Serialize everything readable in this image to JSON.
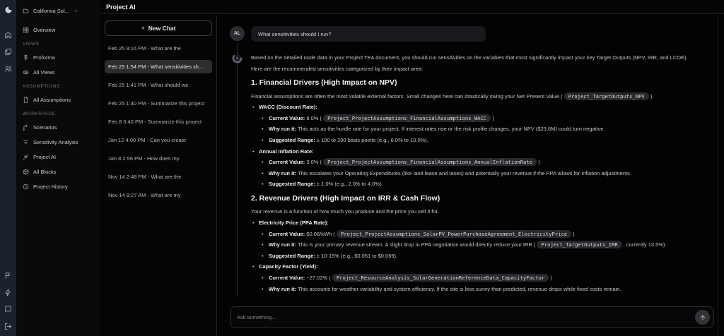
{
  "header": {
    "title": "Project AI"
  },
  "sidebar": {
    "project_label": "California Sol...",
    "overview_label": "Overview",
    "sections": [
      {
        "label": "VIEWS",
        "items": [
          {
            "label": "Proforma"
          },
          {
            "label": "All Views"
          }
        ]
      },
      {
        "label": "ASSUMPTIONS",
        "items": [
          {
            "label": "All Assumptions"
          }
        ]
      },
      {
        "label": "WORKSPACE",
        "items": [
          {
            "label": "Scenarios"
          },
          {
            "label": "Sensitivity Analysis"
          },
          {
            "label": "Project AI"
          },
          {
            "label": "All Blocks"
          },
          {
            "label": "Project History"
          }
        ]
      }
    ]
  },
  "chat_panel": {
    "new_chat_label": "New Chat",
    "items": [
      {
        "label": "Feb 25 9:16 PM - What are the",
        "selected": false
      },
      {
        "label": "Feb 25 1:54 PM - What sensitivities sh...",
        "selected": true
      },
      {
        "label": "Feb 25 1:41 PM - What should we",
        "selected": false
      },
      {
        "label": "Feb 25 1:40 PM - Summarize this project",
        "selected": false
      },
      {
        "label": "Feb 8 3:40 PM - Summarize this project",
        "selected": false
      },
      {
        "label": "Jan 12 4:00 PM - Can you create",
        "selected": false
      },
      {
        "label": "Jan 8 2:56 PM - How does my",
        "selected": false
      },
      {
        "label": "Nov 14 2:48 PM - What are the",
        "selected": false
      },
      {
        "label": "Nov 14 9:27 AM - What are my",
        "selected": false
      }
    ]
  },
  "conversation": {
    "user": {
      "avatar_initials": "AL",
      "message": "What sensitivities should I run?"
    },
    "assistant": {
      "blocks": [
        {
          "type": "p",
          "parts": [
            {
              "t": "text",
              "v": "Based on the detailed node data in your Project TEA document, you should run sensitivities on the variables that most significantly impact your key Target Outputs (NPV, IRR, and LCOE)."
            }
          ]
        },
        {
          "type": "p",
          "parts": [
            {
              "t": "text",
              "v": "Here are the recommended sensitivities categorized by their impact area:"
            }
          ]
        },
        {
          "type": "h3",
          "parts": [
            {
              "t": "text",
              "v": "1. Financial Drivers (High Impact on NPV)"
            }
          ]
        },
        {
          "type": "p",
          "parts": [
            {
              "t": "text",
              "v": "Financial assumptions are often the most volatile external factors. Small changes here can drastically swing your Net Present Value ( "
            },
            {
              "t": "code",
              "v": "Project_TargetOutputs_NPV"
            },
            {
              "t": "text",
              "v": " )."
            }
          ]
        },
        {
          "type": "li1",
          "parts": [
            {
              "t": "bold",
              "v": "WACC (Discount Rate):"
            }
          ]
        },
        {
          "type": "li2",
          "parts": [
            {
              "t": "bold",
              "v": "Current Value:"
            },
            {
              "t": "text",
              "v": " 8.0% ( "
            },
            {
              "t": "code",
              "v": "Project_ProjectAssumptions_FinancialAssumptions_WACC"
            },
            {
              "t": "text",
              "v": " )"
            }
          ]
        },
        {
          "type": "li2",
          "parts": [
            {
              "t": "bold",
              "v": "Why run it:"
            },
            {
              "t": "text",
              "v": " This acts as the hurdle rate for your project. If interest rates rise or the risk profile changes, your NPV ($23.6M) could turn negative."
            }
          ]
        },
        {
          "type": "li2",
          "parts": [
            {
              "t": "bold",
              "v": "Suggested Range:"
            },
            {
              "t": "text",
              "v": " ± 100 to 200 basis points (e.g., 6.0% to 10.0%)."
            }
          ]
        },
        {
          "type": "li1",
          "parts": [
            {
              "t": "bold",
              "v": "Annual Inflation Rate:"
            }
          ]
        },
        {
          "type": "li2",
          "parts": [
            {
              "t": "bold",
              "v": "Current Value:"
            },
            {
              "t": "text",
              "v": " 3.0% ( "
            },
            {
              "t": "code",
              "v": "Project_ProjectAssumptions_FinancialAssumptions_AnnualInflationRate"
            },
            {
              "t": "text",
              "v": " )"
            }
          ]
        },
        {
          "type": "li2",
          "parts": [
            {
              "t": "bold",
              "v": "Why run it:"
            },
            {
              "t": "text",
              "v": " This escalates your Operating Expenditures (like land lease and taxes) and potentially your revenue if the PPA allows for inflation adjustments."
            }
          ]
        },
        {
          "type": "li2",
          "parts": [
            {
              "t": "bold",
              "v": "Suggested Range:"
            },
            {
              "t": "text",
              "v": " ± 1.0% (e.g., 2.0% to 4.0%)."
            }
          ]
        },
        {
          "type": "h3",
          "parts": [
            {
              "t": "text",
              "v": "2. Revenue Drivers (High Impact on IRR & Cash Flow)"
            }
          ]
        },
        {
          "type": "p",
          "parts": [
            {
              "t": "text",
              "v": "Your revenue is a function of how much you produce and the price you sell it for."
            }
          ]
        },
        {
          "type": "li1",
          "parts": [
            {
              "t": "bold",
              "v": "Electricity Price (PPA Rate):"
            }
          ]
        },
        {
          "type": "li2",
          "parts": [
            {
              "t": "bold",
              "v": "Current Value:"
            },
            {
              "t": "text",
              "v": " $0.06/kWh ( "
            },
            {
              "t": "code",
              "v": "Project_ProjectAssumptions_SolarPV_PowerPurchaseAgreement_ElectricityPrice"
            },
            {
              "t": "text",
              "v": " )"
            }
          ]
        },
        {
          "type": "li2",
          "parts": [
            {
              "t": "bold",
              "v": "Why run it:"
            },
            {
              "t": "text",
              "v": " This is your primary revenue stream. A slight drop in PPA negotiation would directly reduce your IRR ( "
            },
            {
              "t": "code",
              "v": "Project_TargetOutputs_IRR"
            },
            {
              "t": "text",
              "v": " , currently 13.5%)."
            }
          ]
        },
        {
          "type": "li2",
          "parts": [
            {
              "t": "bold",
              "v": "Suggested Range:"
            },
            {
              "t": "text",
              "v": " ± 10-15% (e.g., $0.051 to $0.069)."
            }
          ]
        },
        {
          "type": "li1",
          "parts": [
            {
              "t": "bold",
              "v": "Capacity Factor (Yield):"
            }
          ]
        },
        {
          "type": "li2",
          "parts": [
            {
              "t": "bold",
              "v": "Current Value:"
            },
            {
              "t": "text",
              "v": " ~27.02% ( "
            },
            {
              "t": "code",
              "v": "Project_ResourceAnalysis_SolarGenerationReferenceData_CapacityFactor"
            },
            {
              "t": "text",
              "v": " )"
            }
          ]
        },
        {
          "type": "li2",
          "parts": [
            {
              "t": "bold",
              "v": "Why run it:"
            },
            {
              "t": "text",
              "v": " This accounts for weather variability and system efficiency. If the site is less sunny than predicted, revenue drops while fixed costs remain."
            }
          ]
        }
      ]
    }
  },
  "composer": {
    "placeholder": "Ask something..."
  },
  "colors": {
    "rail_bg": "#1c222c",
    "sidebar_bg": "#0a0a0b",
    "panel_bg": "#050505",
    "selected_item_bg": "#2d2d2d",
    "code_chip_bg": "#27292c",
    "border": "#222222"
  }
}
